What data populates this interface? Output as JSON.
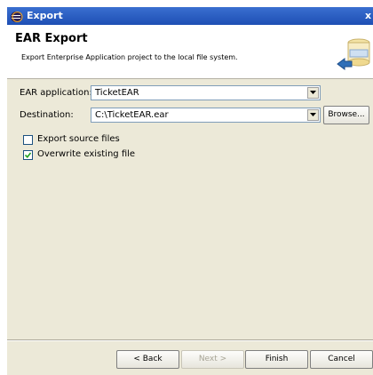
{
  "window": {
    "title": "Export",
    "close_glyph": "x"
  },
  "header": {
    "title": "EAR Export",
    "description": "Export Enterprise Application project to the local file system.",
    "image_icon": "export-wizard-banner-icon"
  },
  "form": {
    "ear_application_label": "EAR application:",
    "ear_application_value": "TicketEAR",
    "destination_label": "Destination:",
    "destination_value": "C:\\TicketEAR.ear",
    "browse_label": "Browse..."
  },
  "options": {
    "export_source": {
      "label": "Export source files",
      "checked": false
    },
    "overwrite": {
      "label": "Overwrite existing file",
      "checked": true
    }
  },
  "buttons": {
    "back": "< Back",
    "next": "Next >",
    "finish": "Finish",
    "cancel": "Cancel"
  },
  "colors": {
    "title_bar": "#1e4fb4",
    "dialog_background": "#ece9d8",
    "header_background": "#ffffff"
  }
}
